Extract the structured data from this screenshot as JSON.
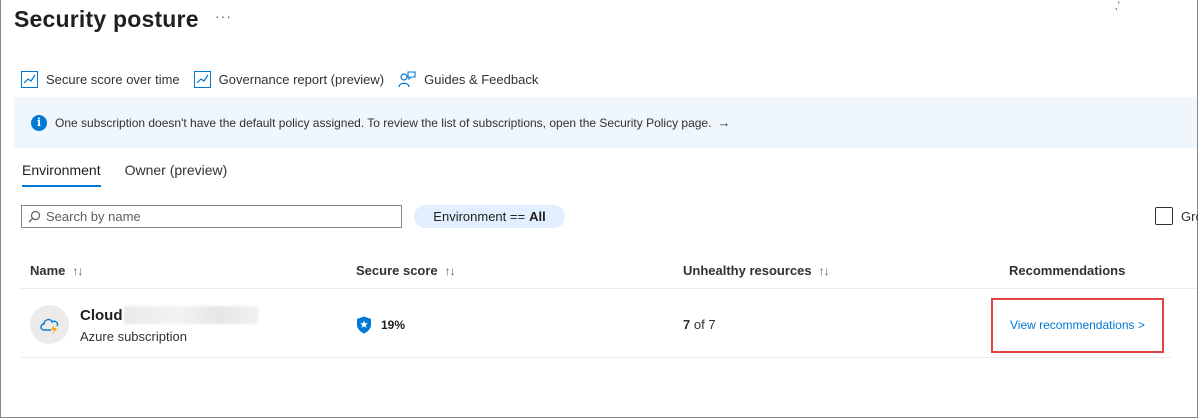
{
  "page": {
    "title": "Security posture",
    "more": "···",
    "corner_mark": "‚’"
  },
  "toolbar": {
    "items": [
      {
        "label": "Secure score over time",
        "icon": "chart-line-icon"
      },
      {
        "label": "Governance report (preview)",
        "icon": "chart-line-icon"
      },
      {
        "label": "Guides & Feedback",
        "icon": "feedback-person-icon"
      }
    ]
  },
  "banner": {
    "icon": "info-icon",
    "text": "One subscription doesn't have the default policy assigned. To review the list of subscriptions, open the Security Policy page.",
    "arrow": "→"
  },
  "tabs": [
    {
      "label": "Environment",
      "active": true
    },
    {
      "label": "Owner (preview)",
      "active": false
    }
  ],
  "search": {
    "placeholder": "Search by name"
  },
  "filter": {
    "prefix": "Environment ==",
    "value": "All"
  },
  "group_checkbox": {
    "label": "Gro",
    "checked": false
  },
  "table": {
    "headers": {
      "name": "Name",
      "secure_score": "Secure score",
      "unhealthy": "Unhealthy resources",
      "recommendations": "Recommendations"
    },
    "sort_glyph": "↑↓",
    "rows": [
      {
        "name": "Cloud",
        "type": "Azure subscription",
        "score": "19%",
        "unhealthy_count": "7",
        "unhealthy_total": "of 7",
        "action": "View recommendations >"
      }
    ]
  },
  "colors": {
    "accent": "#0078d4",
    "banner_bg": "#eff6fc",
    "highlight": "#e04343",
    "pill_bg": "#e1efff"
  }
}
